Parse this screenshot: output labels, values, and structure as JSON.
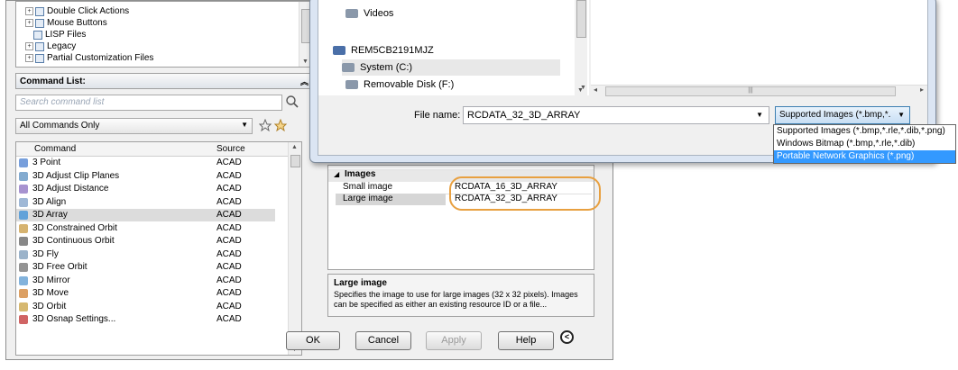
{
  "tree": {
    "items": [
      {
        "label": "Double Click Actions",
        "icon": "folder-icon",
        "expandable": true
      },
      {
        "label": "Mouse Buttons",
        "icon": "folder-icon",
        "expandable": true
      },
      {
        "label": "LISP Files",
        "icon": "folder-icon",
        "expandable": false
      },
      {
        "label": "Legacy",
        "icon": "folder-icon",
        "expandable": true
      },
      {
        "label": "Partial Customization Files",
        "icon": "folder-icon",
        "expandable": true
      }
    ]
  },
  "command_list": {
    "title": "Command List:",
    "search_placeholder": "Search command list",
    "filter_value": "All Commands Only",
    "columns": {
      "command": "Command",
      "source": "Source"
    },
    "rows": [
      {
        "name": "3 Point",
        "source": "ACAD",
        "icon": "3point-icon"
      },
      {
        "name": "3D Adjust Clip Planes",
        "source": "ACAD",
        "icon": "clip-planes-icon"
      },
      {
        "name": "3D Adjust Distance",
        "source": "ACAD",
        "icon": "adjust-distance-icon"
      },
      {
        "name": "3D Align",
        "source": "ACAD",
        "icon": "align-icon"
      },
      {
        "name": "3D Array",
        "source": "ACAD",
        "icon": "array-icon",
        "selected": true
      },
      {
        "name": "3D Constrained Orbit",
        "source": "ACAD",
        "icon": "constrained-orbit-icon"
      },
      {
        "name": "3D Continuous Orbit",
        "source": "ACAD",
        "icon": "continuous-orbit-icon"
      },
      {
        "name": "3D Fly",
        "source": "ACAD",
        "icon": "fly-icon"
      },
      {
        "name": "3D Free Orbit",
        "source": "ACAD",
        "icon": "free-orbit-icon"
      },
      {
        "name": "3D Mirror",
        "source": "ACAD",
        "icon": "mirror-icon"
      },
      {
        "name": "3D Move",
        "source": "ACAD",
        "icon": "move-icon"
      },
      {
        "name": "3D Orbit",
        "source": "ACAD",
        "icon": "orbit-icon"
      },
      {
        "name": "3D Osnap Settings...",
        "source": "ACAD",
        "icon": "osnap-icon"
      }
    ]
  },
  "properties": {
    "group": "Images",
    "rows": [
      {
        "name": "Small image",
        "value": "RCDATA_16_3D_ARRAY"
      },
      {
        "name": "Large image",
        "value": "RCDATA_32_3D_ARRAY"
      }
    ],
    "description_title": "Large image",
    "description_text": "Specifies the image to use for large images (32 x 32 pixels). Images can be specified as either an existing resource ID or a file..."
  },
  "buttons": {
    "ok": "OK",
    "cancel": "Cancel",
    "apply": "Apply",
    "help": "Help"
  },
  "file_dialog": {
    "nav_items": [
      {
        "label": "Videos",
        "icon": "videos-icon"
      },
      {
        "label": "REM5CB2191MJZ",
        "icon": "computer-icon"
      },
      {
        "label": "System (C:)",
        "icon": "drive-icon"
      },
      {
        "label": "Removable Disk (F:)",
        "icon": "removable-disk-icon"
      }
    ],
    "file_name_label": "File name:",
    "file_name_value": "RCDATA_32_3D_ARRAY",
    "file_type_value": "Supported Images (*.bmp,*.",
    "file_type_options": [
      "Supported Images (*.bmp,*.rle,*.dib,*.png)",
      "Windows Bitmap (*.bmp,*.rle,*.dib)",
      "Portable Network Graphics (*.png)"
    ],
    "file_type_highlighted_index": 2
  },
  "colors": {
    "highlight": "#3399ff",
    "circle": "#e8a040",
    "selected_row": "#dcdcdc"
  }
}
